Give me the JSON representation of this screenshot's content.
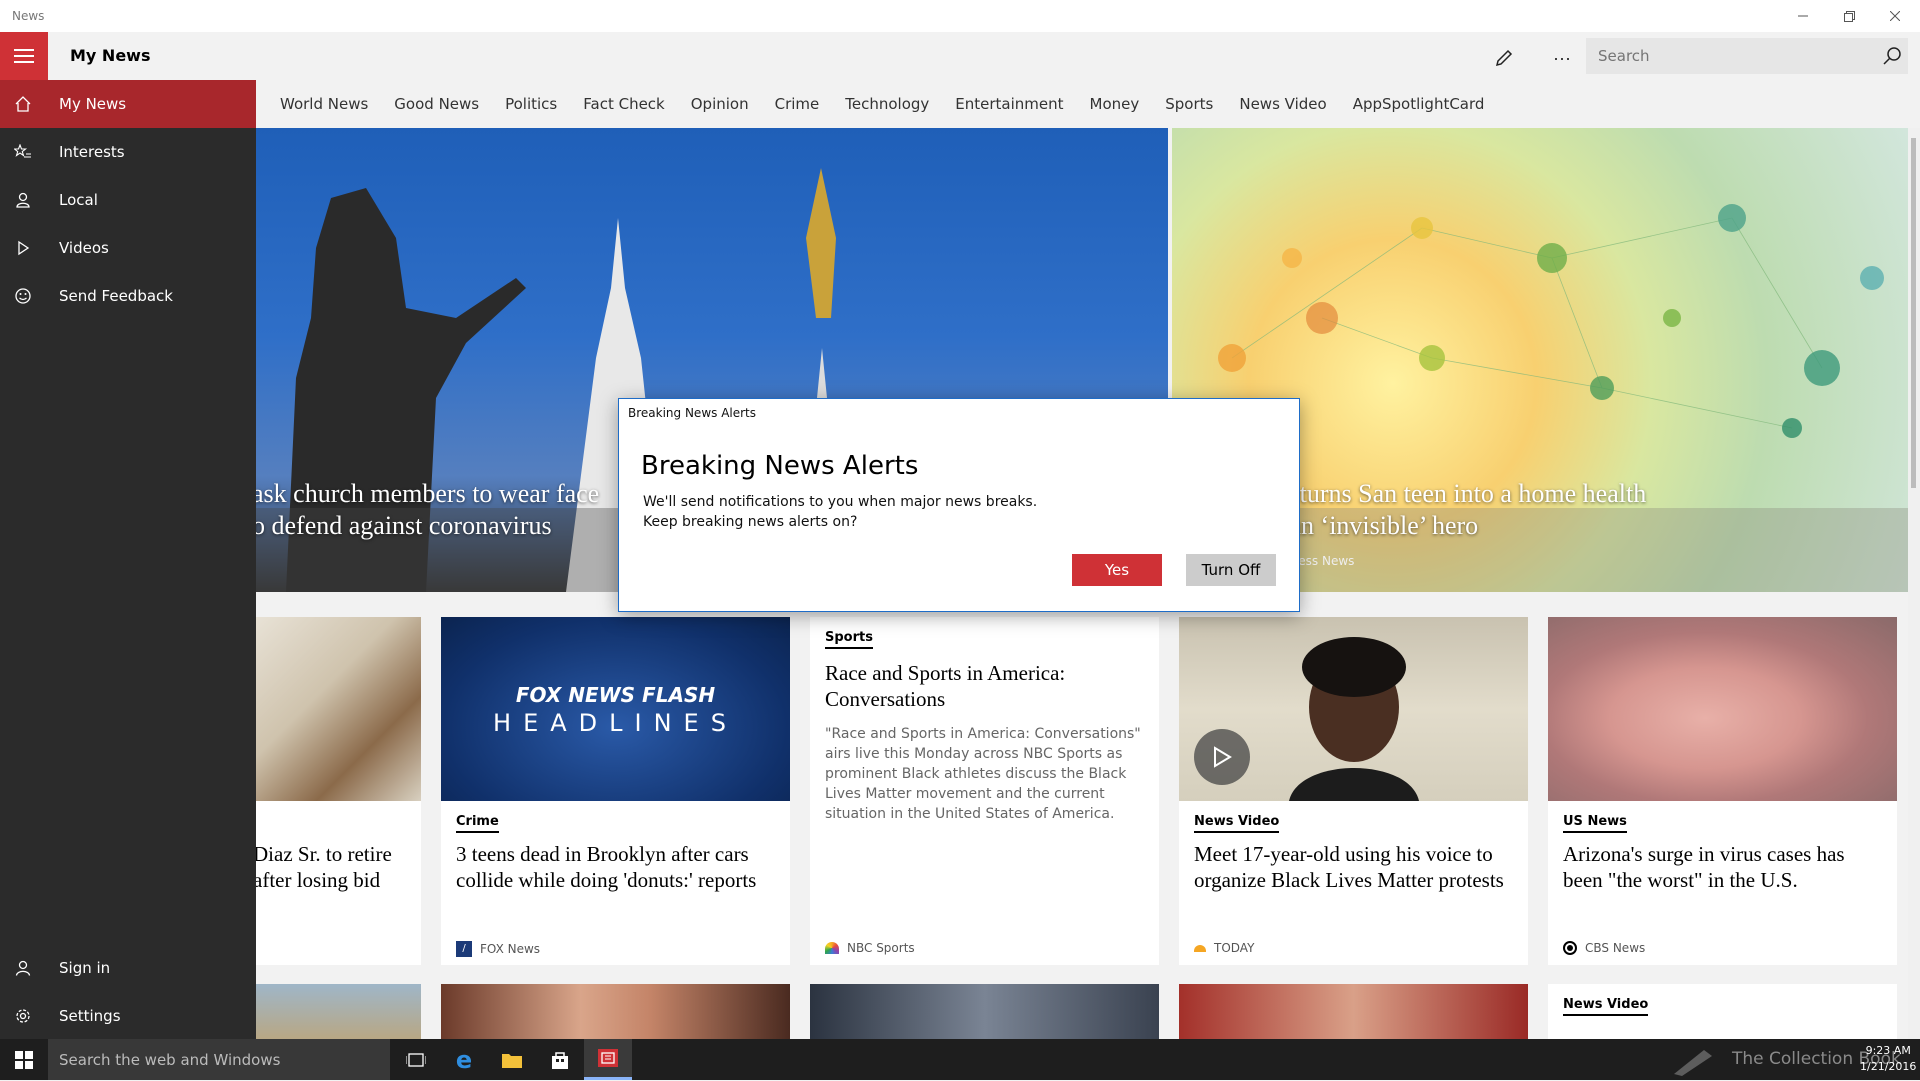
{
  "window": {
    "app_title": "News"
  },
  "header": {
    "page_title": "My News",
    "search_placeholder": "Search"
  },
  "sidebar": {
    "items": [
      {
        "label": "My News",
        "icon": "home-icon"
      },
      {
        "label": "Interests",
        "icon": "star-list-icon"
      },
      {
        "label": "Local",
        "icon": "person-location-icon"
      },
      {
        "label": "Videos",
        "icon": "play-icon"
      },
      {
        "label": "Send Feedback",
        "icon": "smiley-icon"
      }
    ],
    "bottom": [
      {
        "label": "Sign in",
        "icon": "person-icon"
      },
      {
        "label": "Settings",
        "icon": "gear-icon"
      }
    ]
  },
  "tabs": [
    "World News",
    "Good News",
    "Politics",
    "Fact Check",
    "Opinion",
    "Crime",
    "Technology",
    "Entertainment",
    "Money",
    "Sports",
    "News Video",
    "AppSpotlightCard"
  ],
  "hero": [
    {
      "title_line1": "ask church members to wear face",
      "title_line2": "o defend against coronavirus"
    },
    {
      "title_line1": "us turns San teen into a home health",
      "title_line2": "d an ‘invisible’ hero",
      "source": "press News"
    }
  ],
  "cards": [
    {
      "category": "",
      "title": "Diaz Sr. to retire after losing bid",
      "source": ""
    },
    {
      "category": "Crime",
      "title": "3 teens dead in Brooklyn after cars collide while doing 'donuts:' reports",
      "source": "FOX News",
      "image_text_top": "FOX NEWS FLASH",
      "image_text_bottom": "HEADLINES"
    },
    {
      "category": "Sports",
      "title": "Race and Sports in America: Conversations",
      "summary": "\"Race and Sports in America: Conversations\" airs live this Monday across NBC Sports as prominent Black athletes discuss the Black Lives Matter movement and the current situation in the United States of America.",
      "source": "NBC Sports"
    },
    {
      "category": "News Video",
      "title": "Meet 17-year-old using his voice to organize Black Lives Matter protests",
      "source": "TODAY"
    },
    {
      "category": "US News",
      "title": "Arizona's surge in virus cases has been \"the worst\" in the U.S.",
      "source": "CBS News"
    }
  ],
  "row2": {
    "last_category": "News Video"
  },
  "dialog": {
    "caption": "Breaking News Alerts",
    "title": "Breaking News Alerts",
    "line1": "We'll send notifications to you when major news breaks.",
    "line2": "Keep breaking news alerts on?",
    "yes": "Yes",
    "turn_off": "Turn Off"
  },
  "taskbar": {
    "search_placeholder": "Search the web and Windows",
    "time": "9:23 AM",
    "date": "1/21/2016",
    "watermark": "The Collection Book"
  },
  "colors": {
    "accent": "#cf3136",
    "active_nav": "#a8272c",
    "sidebar": "#2b2b2b",
    "dialog_border": "#1e6cc7"
  }
}
